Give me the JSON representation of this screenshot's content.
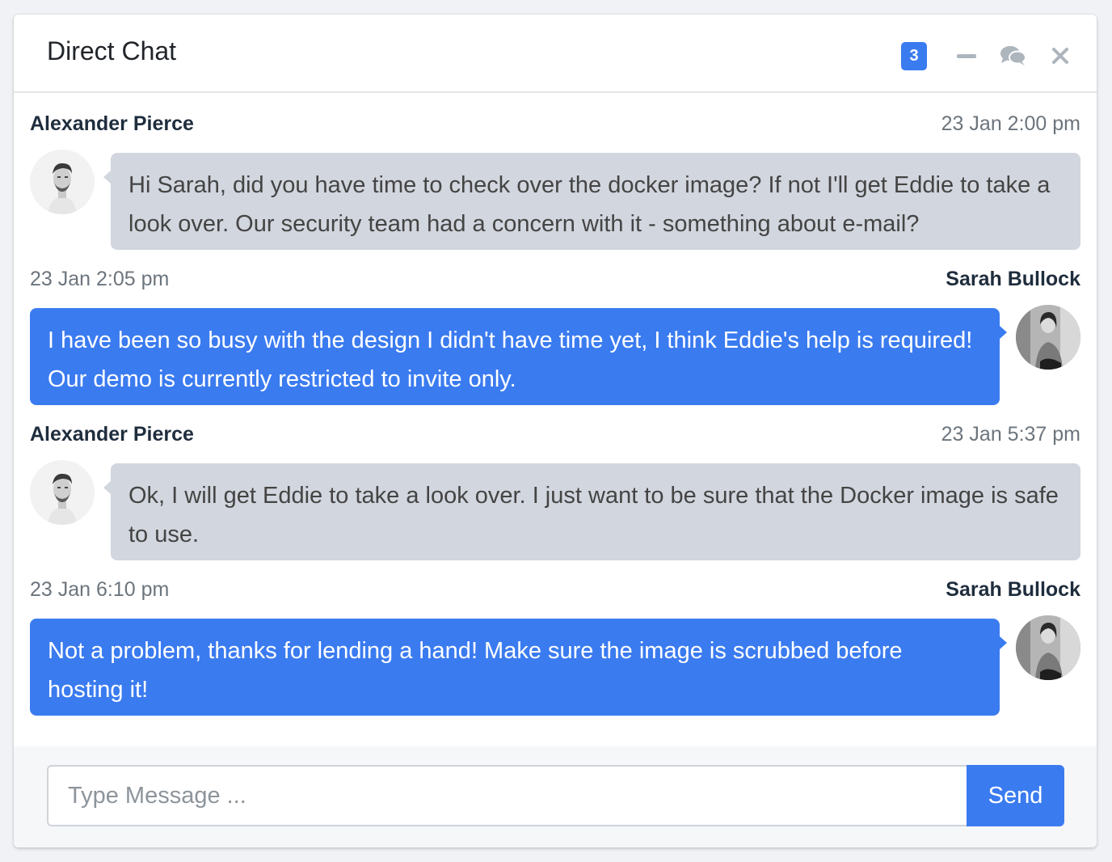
{
  "header": {
    "title": "Direct Chat",
    "badge_count": "3",
    "tools": {
      "collapse": "minus-icon",
      "contacts": "comments-icon",
      "remove": "close-icon"
    }
  },
  "colors": {
    "primary": "#3a7bf0",
    "bubble_received": "#d2d6de",
    "timestamp": "#6c757d"
  },
  "messages": [
    {
      "side": "left",
      "name": "Alexander Pierce",
      "timestamp": "23 Jan 2:00 pm",
      "text": "Hi Sarah, did you have time to check over the docker image? If not I'll get Eddie to take a look over. Our security team had a concern with it - something about e-mail?"
    },
    {
      "side": "right",
      "name": "Sarah Bullock",
      "timestamp": "23 Jan 2:05 pm",
      "text": "I have been so busy with the design I didn't have time yet, I think Eddie's help is required! Our demo is currently restricted to invite only."
    },
    {
      "side": "left",
      "name": "Alexander Pierce",
      "timestamp": "23 Jan 5:37 pm",
      "text": "Ok, I will get Eddie to take a look over. I just want to be sure that the Docker image is safe to use."
    },
    {
      "side": "right",
      "name": "Sarah Bullock",
      "timestamp": "23 Jan 6:10 pm",
      "text": "Not a problem, thanks for lending a hand! Make sure the image is scrubbed before hosting it!"
    }
  ],
  "footer": {
    "input_placeholder": "Type Message ...",
    "input_value": "",
    "send_label": "Send"
  }
}
